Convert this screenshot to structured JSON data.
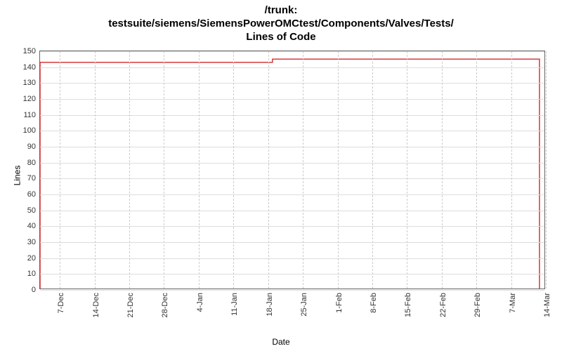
{
  "title_line1": "/trunk:",
  "title_line2": "testsuite/siemens/SiemensPowerOMCtest/Components/Valves/Tests/",
  "title_line3": "Lines of Code",
  "ylabel": "Lines",
  "xlabel": "Date",
  "chart_data": {
    "type": "line",
    "title": "/trunk: testsuite/siemens/SiemensPowerOMCtest/Components/Valves/Tests/ Lines of Code",
    "xlabel": "Date",
    "ylabel": "Lines",
    "ylim": [
      0,
      150
    ],
    "y_ticks": [
      0,
      10,
      20,
      30,
      40,
      50,
      60,
      70,
      80,
      90,
      100,
      110,
      120,
      130,
      140,
      150
    ],
    "x_categories": [
      "7-Dec",
      "14-Dec",
      "21-Dec",
      "28-Dec",
      "4-Jan",
      "11-Jan",
      "18-Jan",
      "25-Jan",
      "1-Feb",
      "8-Feb",
      "15-Feb",
      "22-Feb",
      "29-Feb",
      "7-Mar",
      "14-Mar"
    ],
    "series": [
      {
        "name": "Lines of Code",
        "color": "#d62728",
        "points": [
          {
            "x": "3-Dec",
            "y": 0
          },
          {
            "x": "3-Dec",
            "y": 143
          },
          {
            "x": "19-Jan",
            "y": 143
          },
          {
            "x": "19-Jan",
            "y": 145
          },
          {
            "x": "13-Mar",
            "y": 145
          },
          {
            "x": "13-Mar",
            "y": 0
          }
        ]
      }
    ]
  }
}
